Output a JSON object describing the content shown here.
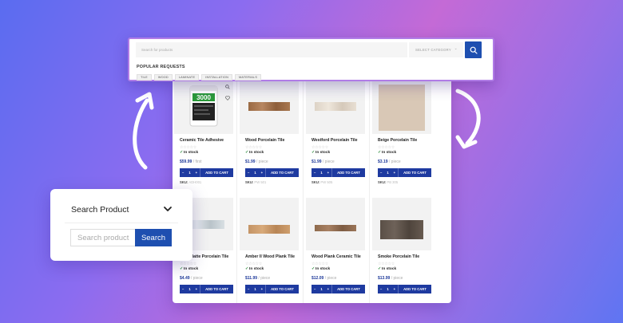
{
  "search_bar": {
    "placeholder": "Search for products",
    "category_label": "SELECT CATEGORY",
    "popular_title": "POPULAR REQUESTS",
    "tags": [
      "TILE",
      "WOOD",
      "LAMINATE",
      "INSTALLATION",
      "MATERIALS"
    ]
  },
  "widget": {
    "title": "Search Product",
    "input_placeholder": "Search product",
    "button_label": "Search"
  },
  "products": [
    {
      "name": "Ceramic Tile Adhesive",
      "stock": "In stock",
      "price": "$59.99",
      "unit": "/ first",
      "sku_label": "SKU:",
      "sku": "ADH001",
      "add_label": "ADD TO CART",
      "qty": "1"
    },
    {
      "name": "Wood Porcelain Tile",
      "stock": "In stock",
      "price": "$1.99",
      "unit": "/ piece",
      "sku_label": "SKU:",
      "sku": "PW 501",
      "add_label": "ADD TO CART",
      "qty": "1"
    },
    {
      "name": "Westford Porcelain Tile",
      "stock": "In stock",
      "price": "$1.99",
      "unit": "/ piece",
      "sku_label": "SKU:",
      "sku": "PW 505",
      "add_label": "ADD TO CART",
      "qty": "1"
    },
    {
      "name": "Beige Porcelain Tile",
      "stock": "In stock",
      "price": "$3.19",
      "unit": "/ piece",
      "sku_label": "SKU:",
      "sku": "PB 305",
      "add_label": "ADD TO CART",
      "qty": "1"
    },
    {
      "name": "Blue Matte Porcelain Tile",
      "stock": "In stock",
      "price": "$4.49",
      "unit": "/ piece",
      "add_label": "ADD TO CART",
      "qty": "1"
    },
    {
      "name": "Amber II Wood Plank Tile",
      "stock": "In stock",
      "price": "$11.99",
      "unit": "/ piece",
      "add_label": "ADD TO CART",
      "qty": "1"
    },
    {
      "name": "Wood Plank Ceramic Tile",
      "stock": "In stock",
      "price": "$12.09",
      "unit": "/ piece",
      "add_label": "ADD TO CART",
      "qty": "1"
    },
    {
      "name": "Smoke Porcelain Tile",
      "stock": "In stock",
      "price": "$13.99",
      "unit": "/ piece",
      "add_label": "ADD TO CART",
      "qty": "1"
    }
  ],
  "colors": {
    "accent": "#1e4fb0",
    "cart_button": "#1e3aa0",
    "in_stock": "#2a8a3a",
    "panel_border": "#b07ce6"
  },
  "icons": {
    "search": "magnifier-icon",
    "wishlist": "heart-icon",
    "quick_view": "magnifier-icon",
    "dropdown": "chevron-down-icon",
    "arrow": "curved-arrow-icon"
  }
}
